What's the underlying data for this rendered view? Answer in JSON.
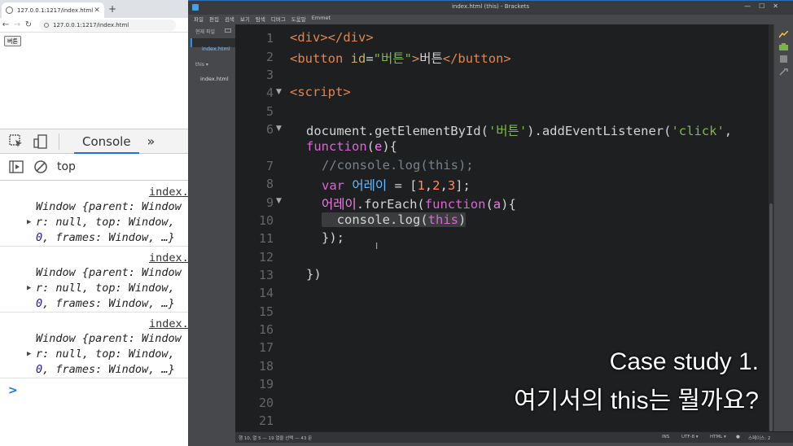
{
  "browser": {
    "tab_title": "127.0.0.1:1217/index.html",
    "url": "127.0.0.1:1217/index.html",
    "page_button_label": "버튼"
  },
  "devtools": {
    "console_tab": "Console",
    "context": "top",
    "messages": [
      {
        "source": "index.",
        "l1": "Window {parent: Window",
        "l2_a": "r: null, top: Window,",
        "l3_num": "0",
        "l3_rest": ", frames: Window, …}"
      },
      {
        "source": "index.",
        "l1": "Window {parent: Window",
        "l2_a": "r: null, top: Window,",
        "l3_num": "0",
        "l3_rest": ", frames: Window, …}"
      },
      {
        "source": "index.",
        "l1": "Window {parent: Window",
        "l2_a": "r: null, top: Window,",
        "l3_num": "0",
        "l3_rest": ", frames: Window, …}"
      }
    ],
    "prompt": ">"
  },
  "editor": {
    "window_title": "index.html (this) - Brackets",
    "menu": [
      "파일",
      "편집",
      "검색",
      "보기",
      "탐색",
      "디버그",
      "도움말",
      "Emmet"
    ],
    "sidebar": {
      "working_files_header": "현재 파일",
      "active_file": "index.html",
      "project": "this ▾",
      "project_file": "index.html"
    },
    "line_numbers": [
      "1",
      "2",
      "3",
      "4",
      "5",
      "6",
      "",
      "7",
      "8",
      "9",
      "10",
      "11",
      "12",
      "13",
      "14",
      "15",
      "16",
      "17",
      "18",
      "19",
      "20",
      "21"
    ],
    "code": {
      "l1_open": "<div>",
      "l1_close": "</div>",
      "l2_tag": "<button",
      "l2_attr": " id",
      "l2_eq": "=",
      "l2_val": "\"버튼\"",
      "l2_gt": ">",
      "l2_text": "버튼",
      "l2_close": "</button>",
      "l4": "<script>",
      "l6_a": "document.getElementById(",
      "l6_str": "'버튼'",
      "l6_b": ").addEventListener(",
      "l6_str2": "'click'",
      "l6_c": ",",
      "l6w_kw": "function",
      "l6w_a": "(",
      "l6w_p": "e",
      "l6w_b": "){",
      "l7": "//console.log(this);",
      "l8_kw": "var",
      "l8_var": " 어레이",
      "l8_eq": " = [",
      "l8_n1": "1",
      "l8_c1": ",",
      "l8_n2": "2",
      "l8_c2": ",",
      "l8_n3": "3",
      "l8_end": "];",
      "l9_var": "어레이",
      "l9_a": ".forEach(",
      "l9_kw": "function",
      "l9_b": "(",
      "l9_p": "a",
      "l9_c": "){",
      "l10_a": "console.log(",
      "l10_kw": "this",
      "l10_b": ")",
      "l11": "});",
      "l13": "})"
    },
    "status": {
      "position": "행 10, 열 5 — 19 열을 선택 — 43 문",
      "ins": "INS",
      "encoding": "UTF-8 ▾",
      "language": "HTML ▾",
      "spaces": "스페이스: 2"
    }
  },
  "caption": {
    "line1": "Case study 1.",
    "line2": "여기서의 this는 뭘까요?"
  }
}
